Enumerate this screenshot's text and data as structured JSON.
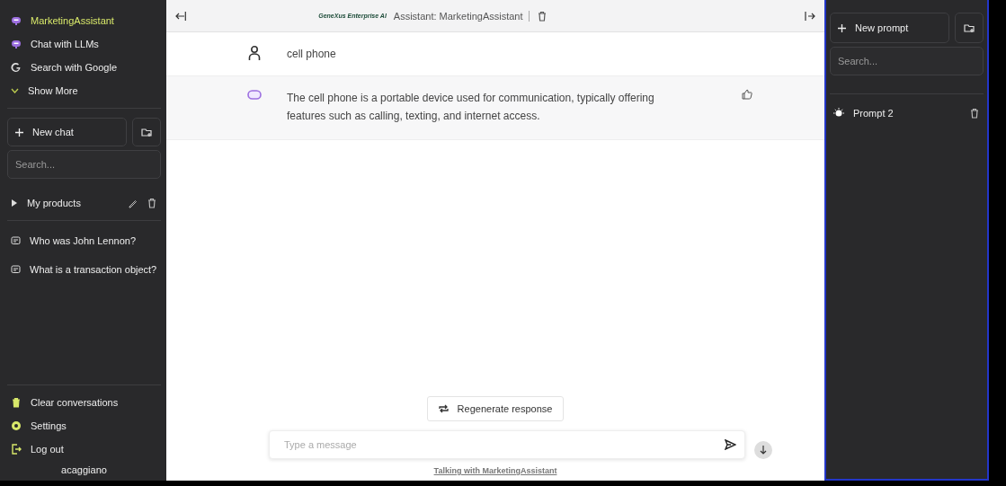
{
  "sidebar": {
    "assistants": [
      {
        "kind": "bot",
        "label": "MarketingAssistant",
        "selected": true
      },
      {
        "kind": "bot",
        "label": "Chat with LLMs",
        "selected": false
      },
      {
        "kind": "google",
        "label": "Search with Google",
        "selected": false
      }
    ],
    "show_more": "Show More",
    "new_chat": "New chat",
    "search": {
      "placeholder": "Search..."
    },
    "folders": [
      {
        "name": "My products",
        "expanded": false
      }
    ],
    "conversations": [
      "Who was John Lennon?",
      "What is a transaction object?"
    ],
    "actions": [
      {
        "kind": "trash",
        "label": "Clear conversations"
      },
      {
        "kind": "gear",
        "label": "Settings"
      },
      {
        "kind": "logout",
        "label": "Log out"
      }
    ],
    "user": "acaggiano"
  },
  "header": {
    "logo": "GeneXus Enterprise AI",
    "title": "Assistant: MarketingAssistant"
  },
  "messages": [
    {
      "kind": "user",
      "text": "cell phone"
    },
    {
      "kind": "assistant",
      "text": "The cell phone is a portable device used for communication, typically offering features such as calling, texting, and internet access."
    }
  ],
  "regenerate": "Regenerate response",
  "composer": {
    "placeholder": "Type a message"
  },
  "footer_link": "Talking with MarketingAssistant",
  "prompt_panel": {
    "new_prompt": "New prompt",
    "search": {
      "placeholder": "Search..."
    },
    "prompts": [
      "Prompt 2"
    ]
  }
}
